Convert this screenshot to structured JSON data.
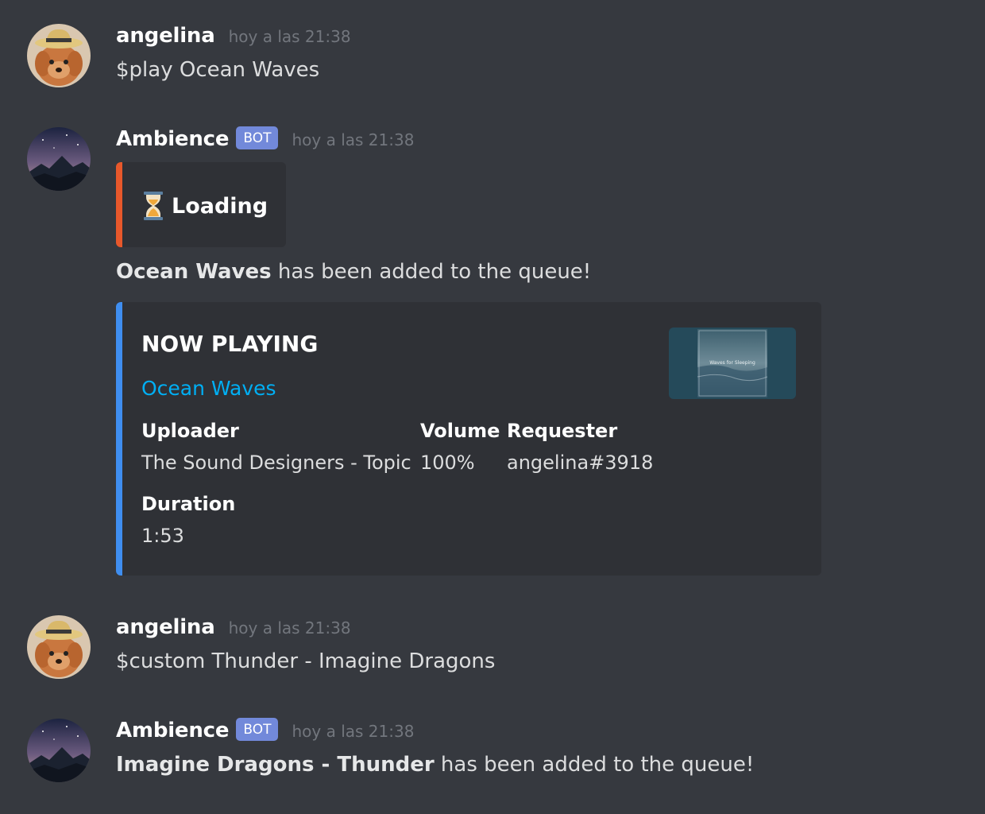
{
  "messages": [
    {
      "author": "angelina",
      "timestamp": "hoy a las 21:38",
      "text": "$play Ocean Waves"
    },
    {
      "author": "Ambience",
      "bot_tag": "BOT",
      "timestamp": "hoy a las 21:38",
      "loading_embed": {
        "icon": "hourglass-icon",
        "text": "Loading",
        "accent_color": "#e8582b"
      },
      "queued_title": "Ocean Waves",
      "queued_suffix": " has been added to the queue!",
      "now_playing_embed": {
        "accent_color": "#3f8ef0",
        "title": "NOW PLAYING",
        "track_link": "Ocean Waves",
        "thumbnail_caption": "Waves for Sleeping",
        "fields": {
          "uploader": {
            "name": "Uploader",
            "value": "The Sound Designers - Topic"
          },
          "volume": {
            "name": "Volume",
            "value": "100%"
          },
          "requester": {
            "name": "Requester",
            "value": "angelina#3918"
          },
          "duration": {
            "name": "Duration",
            "value": "1:53"
          }
        }
      }
    },
    {
      "author": "angelina",
      "timestamp": "hoy a las 21:38",
      "text": "$custom Thunder - Imagine Dragons"
    },
    {
      "author": "Ambience",
      "bot_tag": "BOT",
      "timestamp": "hoy a las 21:38",
      "queued_title": "Imagine Dragons - Thunder",
      "queued_suffix": " has been added to the queue!"
    }
  ],
  "colors": {
    "background": "#36393f",
    "embed_background": "#2f3136",
    "bot_tag": "#7289da",
    "link": "#00aff4",
    "timestamp": "#72767d"
  }
}
